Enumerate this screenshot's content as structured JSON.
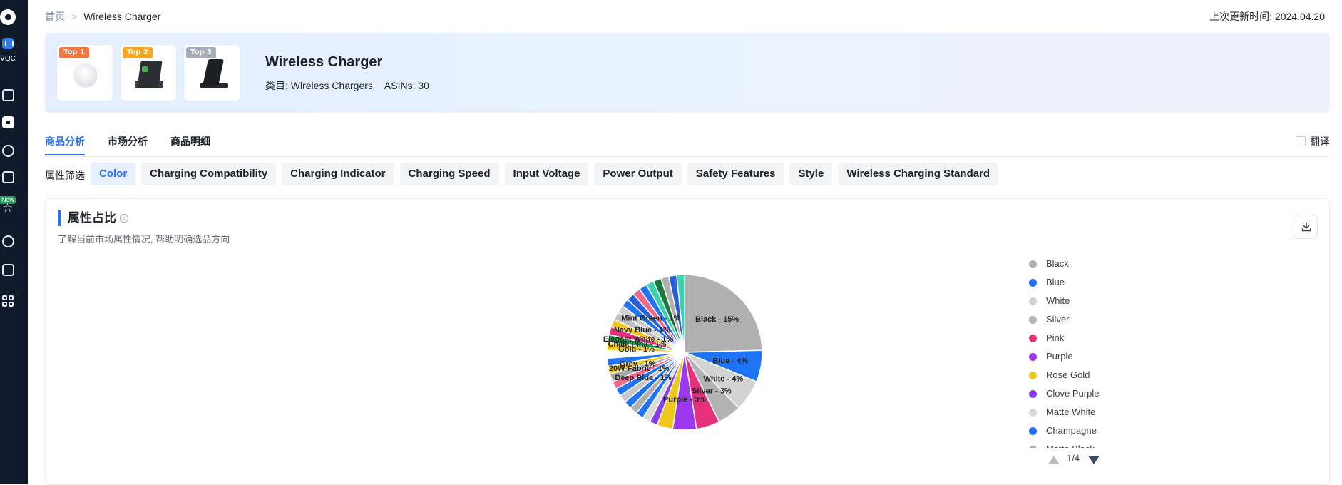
{
  "app": {
    "name": "VOC",
    "badge_new": "New"
  },
  "breadcrumb": {
    "home": "首页",
    "current": "Wireless Charger"
  },
  "updated": "上次更新时间: 2024.04.20",
  "product": {
    "title": "Wireless Charger",
    "category": "类目: Wireless Chargers",
    "asins": "ASINs: 30",
    "tops": [
      "Top 1",
      "Top 2",
      "Top 3"
    ]
  },
  "tabs": [
    "商品分析",
    "市场分析",
    "商品明细"
  ],
  "translate_label": "翻译",
  "filter": {
    "label": "属性筛选",
    "chips": [
      "Color",
      "Charging Compatibility",
      "Charging Indicator",
      "Charging Speed",
      "Input Voltage",
      "Power Output",
      "Safety Features",
      "Style",
      "Wireless Charging Standard"
    ]
  },
  "section": {
    "title": "属性占比",
    "subtitle": "了解当前市场属性情况, 帮助明确选品方向"
  },
  "chart_data": {
    "type": "pie",
    "slices": [
      {
        "label": "Black",
        "value": 15,
        "color": "#b0b0b0",
        "shown": true
      },
      {
        "label": "Blue",
        "value": 4,
        "color": "#1e74f5",
        "shown": true
      },
      {
        "label": "White",
        "value": 4,
        "color": "#d3d3d3",
        "shown": true
      },
      {
        "label": "Silver",
        "value": 3,
        "color": "#b3b3b3",
        "shown": true
      },
      {
        "label": "Pink",
        "value": 3,
        "color": "#e8317d"
      },
      {
        "label": "Purple",
        "value": 3,
        "color": "#9b38f0",
        "shown": true
      },
      {
        "label": "Rose Gold",
        "value": 2,
        "color": "#f0c81b"
      },
      {
        "label": "Clove Purple",
        "value": 1,
        "color": "#8a3ee6"
      },
      {
        "label": "Matte White",
        "value": 1,
        "color": "#d9d9d9"
      },
      {
        "label": "Champagne",
        "value": 1,
        "color": "#1e74f5"
      },
      {
        "label": "",
        "value": 1,
        "color": "#b0b0b0"
      },
      {
        "label": "",
        "value": 1,
        "color": "#1e74f5"
      },
      {
        "label": "",
        "value": 1,
        "color": "#c8c8c8"
      },
      {
        "label": "Deep Blue",
        "value": 1,
        "color": "#1e74f5",
        "shown": true
      },
      {
        "label": "",
        "value": 1,
        "color": "#f06b8a"
      },
      {
        "label": "20W-Fabric",
        "value": 1,
        "color": "#a8a8a8",
        "shown": true
      },
      {
        "label": "Grey",
        "value": 1,
        "color": "#f0c81b",
        "shown": true
      },
      {
        "label": "",
        "value": 1,
        "color": "#1e74f5"
      },
      {
        "label": "",
        "value": 1,
        "color": "#ffffff"
      },
      {
        "label": "Gold",
        "value": 1,
        "color": "#f0c81b",
        "shown": true
      },
      {
        "label": "Chalk Pink",
        "value": 1,
        "color": "#1fae4a",
        "shown": true
      },
      {
        "label": "Elegant White",
        "value": 1,
        "color": "#e8317d",
        "shown": true
      },
      {
        "label": "",
        "value": 1,
        "color": "#f0c81b"
      },
      {
        "label": "Navy Blue",
        "value": 1,
        "color": "#c0c0c0",
        "shown": true
      },
      {
        "label": "",
        "value": 1,
        "color": "#d0d0d0"
      },
      {
        "label": "",
        "value": 1,
        "color": "#1e74f5"
      },
      {
        "label": "Mint Green",
        "value": 1,
        "color": "#2b5fd9",
        "shown": true
      },
      {
        "label": "",
        "value": 1,
        "color": "#f06b8a"
      },
      {
        "label": "",
        "value": 1,
        "color": "#1e74f5"
      },
      {
        "label": "",
        "value": 1,
        "color": "#3ccfb0"
      },
      {
        "label": "",
        "value": 1,
        "color": "#1a7a3a"
      },
      {
        "label": "",
        "value": 1,
        "color": "#b0b0b0"
      },
      {
        "label": "",
        "value": 1,
        "color": "#2b5fd9"
      },
      {
        "label": "",
        "value": 1,
        "color": "#3ccfb0"
      }
    ],
    "legend": [
      {
        "name": "Black",
        "color": "#b0b0b0"
      },
      {
        "name": "Blue",
        "color": "#1e74f5"
      },
      {
        "name": "White",
        "color": "#d3d3d3"
      },
      {
        "name": "Silver",
        "color": "#b3b3b3"
      },
      {
        "name": "Pink",
        "color": "#e8317d"
      },
      {
        "name": "Purple",
        "color": "#9b38f0"
      },
      {
        "name": "Rose Gold",
        "color": "#f0c81b"
      },
      {
        "name": "Clove Purple",
        "color": "#8a3ee6"
      },
      {
        "name": "Matte White",
        "color": "#d9d9d9"
      },
      {
        "name": "Champagne",
        "color": "#1e74f5"
      },
      {
        "name": "Matte Black",
        "color": "#b0b0b0"
      }
    ],
    "legend_position": "right",
    "legend_page": "1/4"
  }
}
